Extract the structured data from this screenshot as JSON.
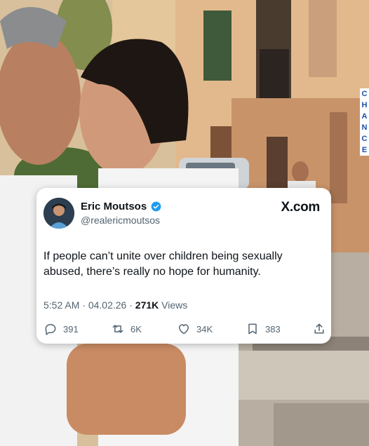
{
  "tweet": {
    "author_name": "Eric Moutsos",
    "handle": "@realericmoutsos",
    "brand": "X.com",
    "text": "If people can’t unite over children being sexually abused, there’s really no hope for humanity.",
    "time": "5:52 AM",
    "date": "04.02.26",
    "views_count": "271K",
    "views_label": "Views",
    "replies": "391",
    "reposts": "6K",
    "likes": "34K",
    "bookmarks": "383"
  },
  "background": {
    "sign_letters": [
      "C",
      "H",
      "A",
      "N",
      "C",
      "E"
    ]
  },
  "colors": {
    "verified": "#1d9bf0",
    "text_primary": "#0f1419",
    "text_secondary": "#536471"
  },
  "icons": [
    "reply-icon",
    "repost-icon",
    "like-icon",
    "bookmark-icon",
    "share-icon",
    "verified-badge-icon"
  ]
}
